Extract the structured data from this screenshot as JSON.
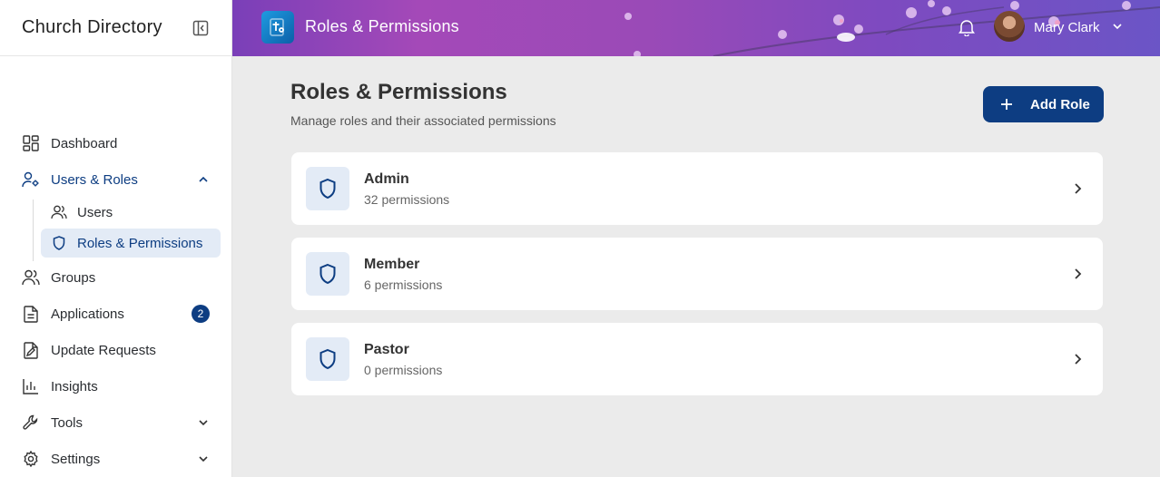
{
  "sidebar": {
    "title": "Church Directory",
    "items": [
      {
        "label": "Dashboard",
        "icon": "dashboard-icon"
      },
      {
        "label": "Users & Roles",
        "icon": "users-roles-icon"
      },
      {
        "label": "Groups",
        "icon": "groups-icon"
      },
      {
        "label": "Applications",
        "icon": "applications-icon",
        "badge": "2"
      },
      {
        "label": "Update Requests",
        "icon": "update-requests-icon"
      },
      {
        "label": "Insights",
        "icon": "insights-icon"
      },
      {
        "label": "Tools",
        "icon": "tools-icon"
      },
      {
        "label": "Settings",
        "icon": "settings-icon"
      }
    ],
    "sub_items": [
      {
        "label": "Users",
        "icon": "user-icon"
      },
      {
        "label": "Roles & Permissions",
        "icon": "shield-icon"
      }
    ]
  },
  "header": {
    "title": "Roles & Permissions",
    "user_name": "Mary Clark"
  },
  "main": {
    "title": "Roles & Permissions",
    "subtitle": "Manage roles and their associated permissions",
    "add_button": "Add Role",
    "roles": [
      {
        "name": "Admin",
        "count": "32 permissions"
      },
      {
        "name": "Member",
        "count": "6 permissions"
      },
      {
        "name": "Pastor",
        "count": "0 permissions"
      }
    ]
  },
  "colors": {
    "accent": "#0d3d82",
    "active_bg": "#e3ebf6",
    "page_bg": "#ebebeb"
  }
}
